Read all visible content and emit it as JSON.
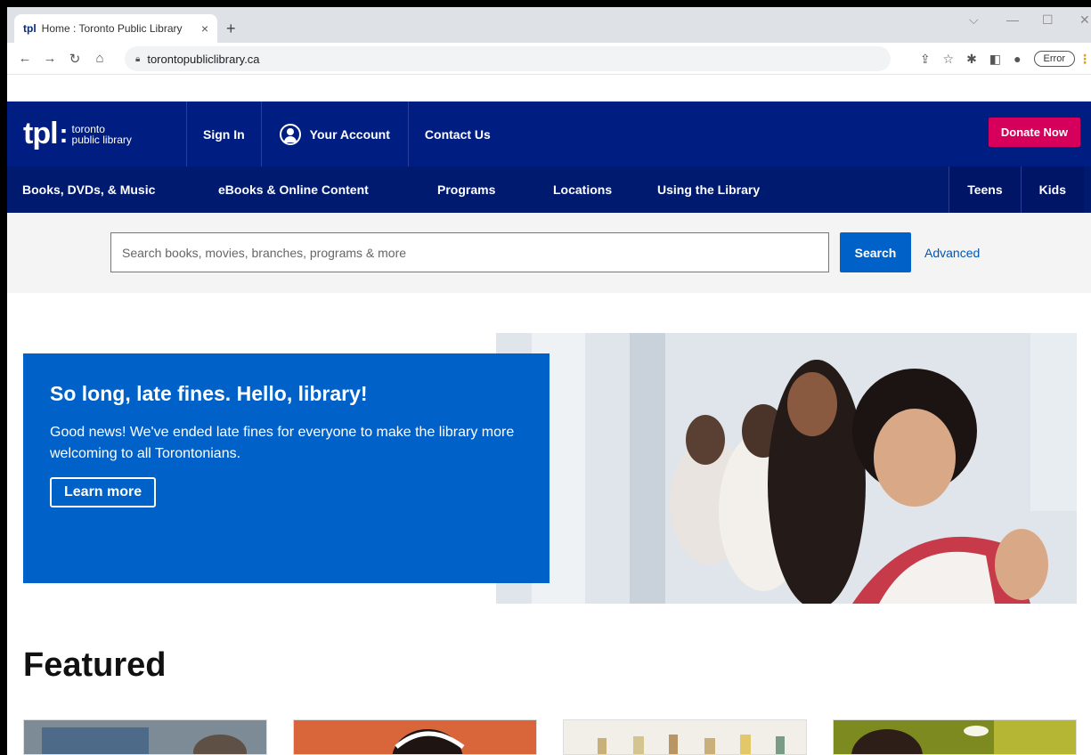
{
  "browser": {
    "tab_favicon": "tpl",
    "tab_title": "Home : Toronto Public Library",
    "tab_close": "×",
    "new_tab": "+",
    "url": "torontopubliclibrary.ca",
    "error_label": "Error",
    "window_controls": [
      "⌵",
      "—",
      "☐",
      "✕"
    ]
  },
  "header": {
    "logo_mark": "tpl",
    "logo_line1": "toronto",
    "logo_line2": "public library",
    "links": [
      "Sign In",
      "Your Account",
      "Contact Us"
    ],
    "donate_label": "Donate Now"
  },
  "nav": {
    "items": [
      "Books, DVDs, & Music",
      "eBooks & Online Content",
      "Programs",
      "Locations",
      "Using the Library"
    ],
    "right_items": [
      "Teens",
      "Kids"
    ]
  },
  "search": {
    "placeholder": "Search books, movies, branches, programs & more",
    "button_label": "Search",
    "advanced_label": "Advanced"
  },
  "hero": {
    "title": "So long, late fines. Hello, library!",
    "body": "Good news! We've ended late fines for everyone to make the library more welcoming to all Torontonians.",
    "cta": "Learn more"
  },
  "featured": {
    "heading": "Featured"
  },
  "colors": {
    "header_blue": "#001d82",
    "nav_blue": "#001a70",
    "accent_blue": "#0061c9",
    "donate_pink": "#d6005c"
  }
}
